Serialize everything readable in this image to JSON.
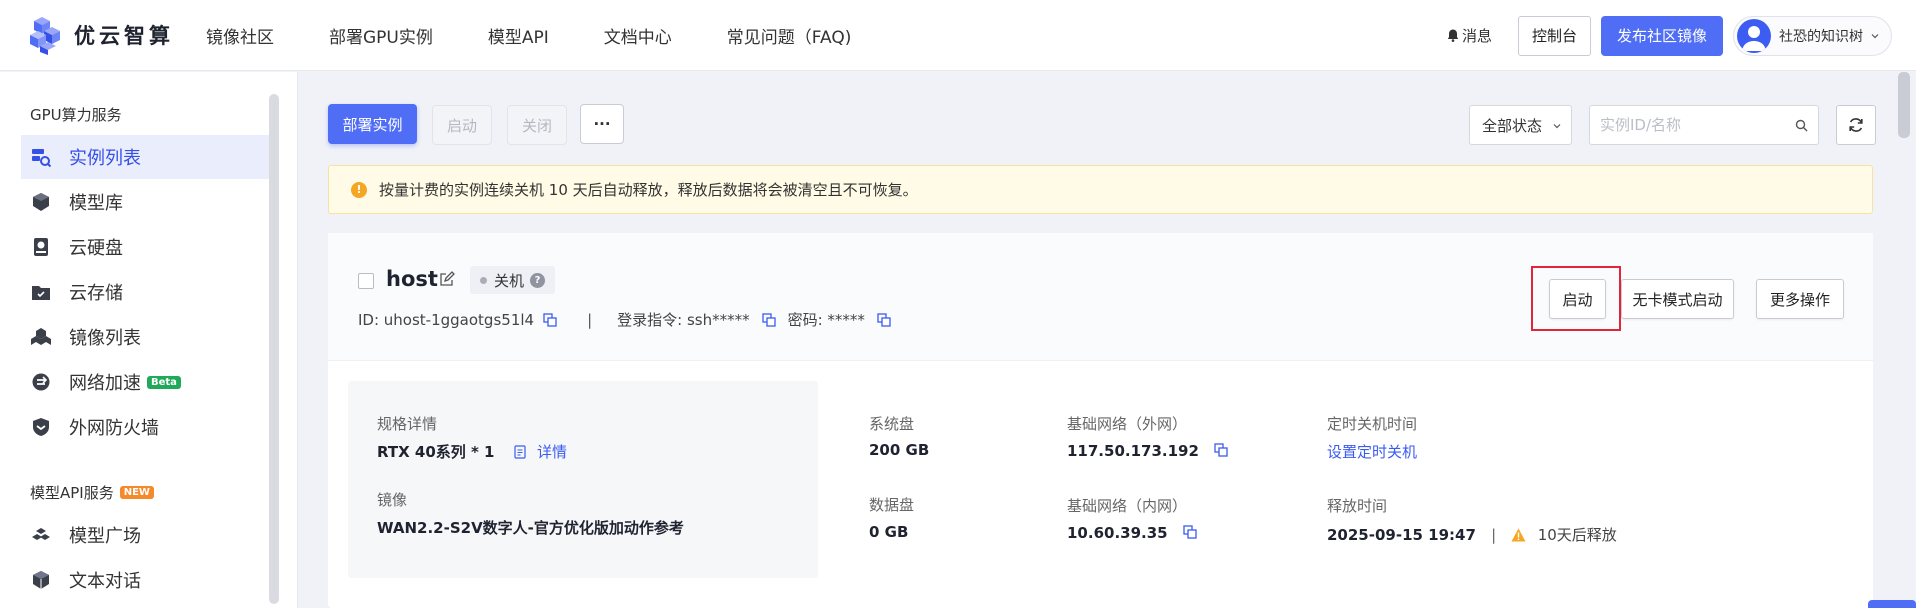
{
  "brand": {
    "name": "优云智算"
  },
  "topnav": [
    "镜像社区",
    "部署GPU实例",
    "模型API",
    "文档中心",
    "常见问题（FAQ)"
  ],
  "top_right": {
    "messages": "消息",
    "console": "控制台",
    "publish": "发布社区镜像",
    "user_name": "社恐的知识树"
  },
  "sidebar": {
    "section_gpu": "GPU算力服务",
    "gpu_items": [
      {
        "label": "实例列表",
        "icon": "server-list-icon",
        "active": true
      },
      {
        "label": "模型库",
        "icon": "cube-icon"
      },
      {
        "label": "云硬盘",
        "icon": "disk-icon"
      },
      {
        "label": "云存储",
        "icon": "folder-icon"
      },
      {
        "label": "镜像列表",
        "icon": "images-icon"
      },
      {
        "label": "网络加速",
        "icon": "network-icon",
        "badge": "Beta"
      },
      {
        "label": "外网防火墙",
        "icon": "shield-icon"
      }
    ],
    "section_api": "模型API服务",
    "section_api_badge": "NEW",
    "api_items": [
      {
        "label": "模型广场",
        "icon": "model-plaza-icon"
      },
      {
        "label": "文本对话",
        "icon": "box-icon"
      }
    ]
  },
  "toolbar": {
    "deploy": "部署实例",
    "start": "启动",
    "stop": "关闭",
    "more": "···",
    "status_filter": "全部状态",
    "search_placeholder": "实例ID/名称"
  },
  "notice": "按量计费的实例连续关机 10 天后自动释放，释放后数据将会被清空且不可恢复。",
  "instance": {
    "name": "host",
    "state": "关机",
    "id_label": "ID: uhost-1ggaotgs51l4",
    "login_label": "登录指令: ssh*****",
    "password_label": "密码: *****",
    "actions": {
      "start": "启动",
      "cardless_start": "无卡模式启动",
      "more": "更多操作"
    },
    "spec_label": "规格详情",
    "spec_value": "RTX 40系列 * 1",
    "spec_link": "详情",
    "image_label": "镜像",
    "image_value": "WAN2.2-S2V数字人-官方优化版加动作参考",
    "sys_disk_label": "系统盘",
    "sys_disk_value": "200 GB",
    "data_disk_label": "数据盘",
    "data_disk_value": "0 GB",
    "ext_net_label": "基础网络（外网）",
    "ext_net_value": "117.50.173.192",
    "int_net_label": "基础网络（内网）",
    "int_net_value": "10.60.39.35",
    "shutdown_label": "定时关机时间",
    "shutdown_link": "设置定时关机",
    "release_label": "释放时间",
    "release_value": "2025-09-15 19:47",
    "release_sep": "|",
    "release_note": "10天后释放"
  }
}
